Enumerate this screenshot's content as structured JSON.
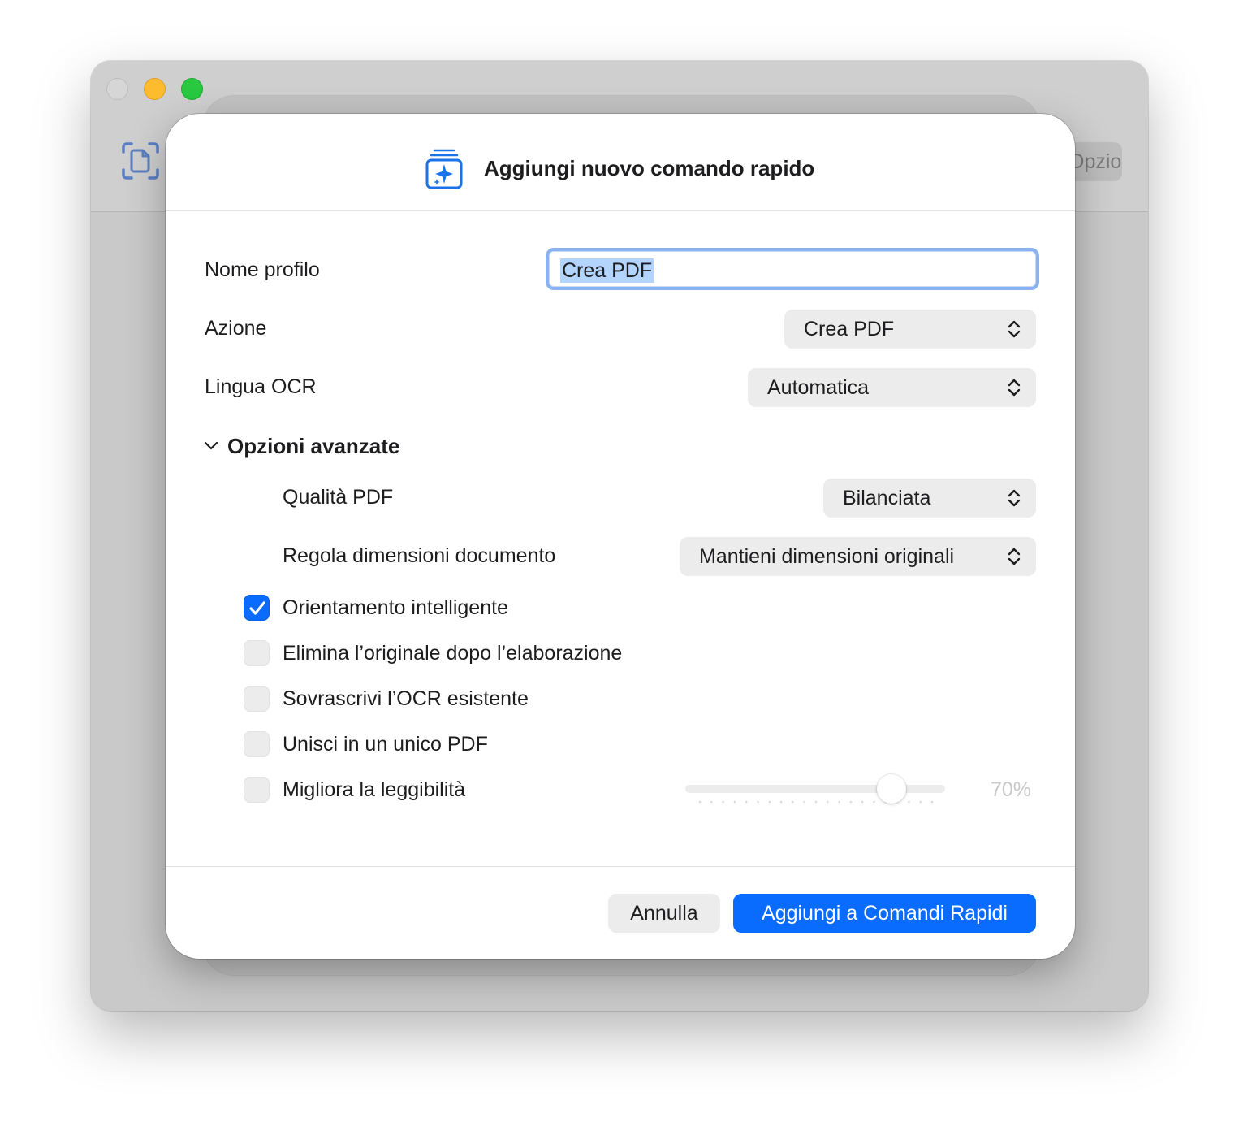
{
  "background_window": {
    "tab_partial_label": "Opzioni"
  },
  "dialog": {
    "title": "Aggiungi nuovo comando rapido",
    "icon": "shortcut-stack-sparkle-icon",
    "fields": {
      "profile_name_label": "Nome profilo",
      "profile_name_value": "Crea PDF",
      "action_label": "Azione",
      "action_value": "Crea PDF",
      "ocr_language_label": "Lingua OCR",
      "ocr_language_value": "Automatica"
    },
    "advanced": {
      "title": "Opzioni avanzate",
      "expanded": true,
      "pdf_quality_label": "Qualità PDF",
      "pdf_quality_value": "Bilanciata",
      "resize_label": "Regola dimensioni documento",
      "resize_value": "Mantieni dimensioni originali",
      "checkboxes": [
        {
          "label": "Orientamento intelligente",
          "checked": true
        },
        {
          "label": "Elimina l’originale dopo l’elaborazione",
          "checked": false
        },
        {
          "label": "Sovrascrivi l’OCR esistente",
          "checked": false
        },
        {
          "label": "Unisci in un unico PDF",
          "checked": false
        },
        {
          "label": "Migliora la leggibilità",
          "checked": false
        }
      ],
      "readability_slider": {
        "value_percent": 70,
        "value_label": "70%",
        "enabled": false
      }
    },
    "buttons": {
      "cancel": "Annulla",
      "confirm": "Aggiungi a Comandi Rapidi"
    }
  },
  "colors": {
    "accent": "#0a6cff",
    "focus_ring": "#89b3f0",
    "selection": "#b3d4fc",
    "control_bg": "#ececec"
  }
}
